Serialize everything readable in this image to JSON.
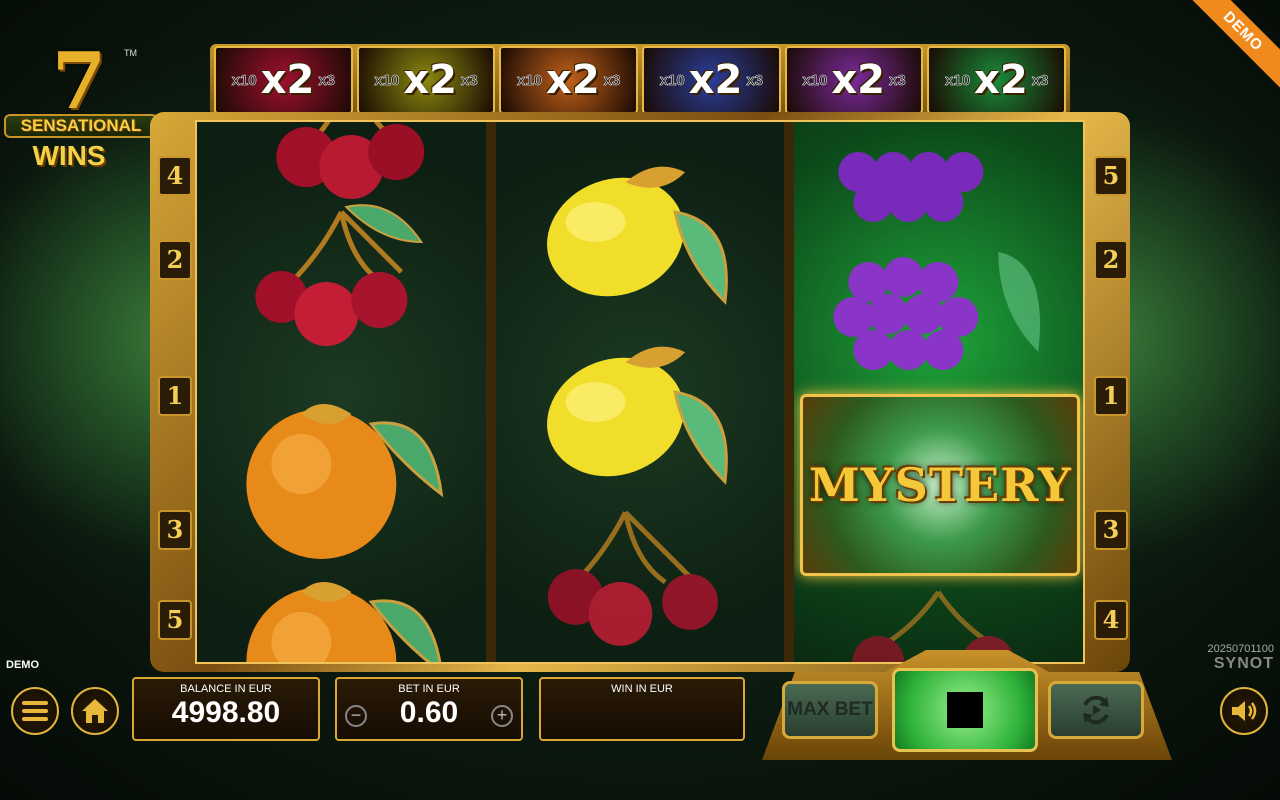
{
  "demo_ribbon": "DEMO",
  "logo": {
    "number": "7",
    "trademark": "TM",
    "line1": "SENSATIONAL",
    "line2": "WINS"
  },
  "multipliers": [
    {
      "left": "x10",
      "main": "x2",
      "right": "x3",
      "color": "#a01030"
    },
    {
      "left": "x10",
      "main": "x2",
      "right": "x3",
      "color": "#8a8a10"
    },
    {
      "left": "x10",
      "main": "x2",
      "right": "x3",
      "color": "#c0601a"
    },
    {
      "left": "x10",
      "main": "x2",
      "right": "x3",
      "color": "#2a3e9a"
    },
    {
      "left": "x10",
      "main": "x2",
      "right": "x3",
      "color": "#7a2a9a"
    },
    {
      "left": "x10",
      "main": "x2",
      "right": "x3",
      "color": "#1a8a3a"
    }
  ],
  "reels": [
    {
      "symbols": [
        "cherry",
        "cherry",
        "orange",
        "orange"
      ]
    },
    {
      "symbols": [
        "lemon",
        "lemon",
        "cherry"
      ]
    },
    {
      "symbols": [
        "grapes",
        "grapes",
        "mystery",
        "cherry"
      ],
      "highlighted": true
    }
  ],
  "mystery_label": "MYSTERY",
  "paylines_left": [
    "4",
    "2",
    "1",
    "3",
    "5"
  ],
  "paylines_right": [
    "5",
    "2",
    "1",
    "3",
    "4"
  ],
  "demo_label": "DEMO",
  "build_number": "20250701100",
  "brand": "SYNOT",
  "balance": {
    "label": "BALANCE IN EUR",
    "value": "4998.80"
  },
  "bet": {
    "label": "BET IN EUR",
    "value": "0.60",
    "decrease": "−",
    "increase": "+"
  },
  "win": {
    "label": "WIN IN EUR",
    "value": ""
  },
  "buttons": {
    "max_bet": "MAX BET",
    "menu": "menu-icon",
    "home": "home-icon",
    "spin": "stop-icon",
    "autoplay": "autoplay-icon",
    "sound": "sound-icon"
  }
}
